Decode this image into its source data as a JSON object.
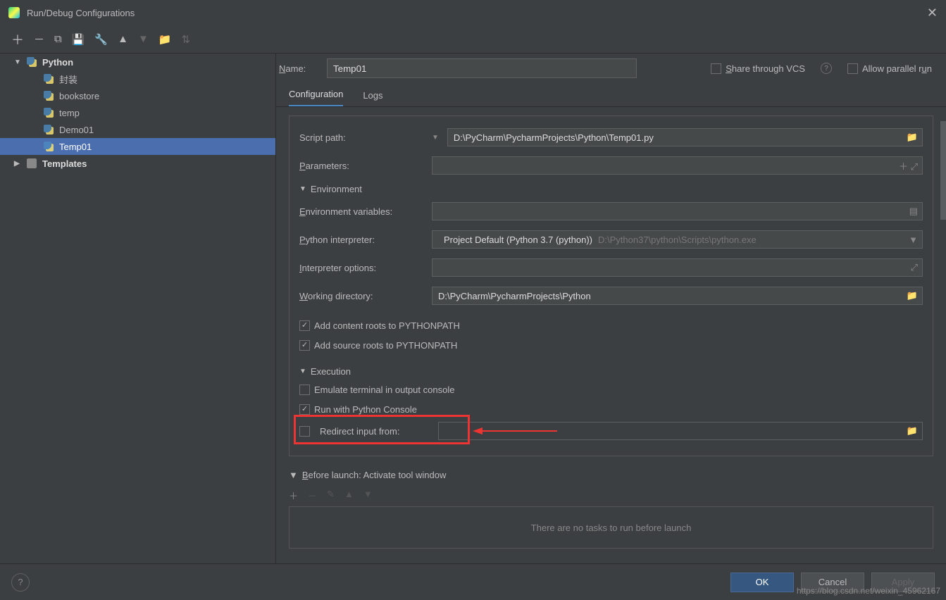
{
  "window": {
    "title": "Run/Debug Configurations"
  },
  "sidebar": {
    "group": "Python",
    "items": [
      "封装",
      "bookstore",
      "temp",
      "Demo01",
      "Temp01"
    ],
    "selected_index": 4,
    "templates": "Templates"
  },
  "header": {
    "name_label": "Name:",
    "name_value": "Temp01",
    "share_label": "Share through VCS",
    "share_checked": false,
    "parallel_label": "Allow parallel run",
    "parallel_checked": false
  },
  "tabs": {
    "items": [
      "Configuration",
      "Logs"
    ],
    "active": 0
  },
  "config": {
    "script_path_label": "Script path:",
    "script_path_value": "D:\\PyCharm\\PycharmProjects\\Python\\Temp01.py",
    "parameters_label": "Parameters:",
    "parameters_value": "",
    "env_header": "Environment",
    "env_vars_label": "Environment variables:",
    "env_vars_value": "",
    "interpreter_label": "Python interpreter:",
    "interpreter_value": "Project Default (Python 3.7 (python))",
    "interpreter_path": "D:\\Python37\\python\\Scripts\\python.exe",
    "interpreter_opts_label": "Interpreter options:",
    "interpreter_opts_value": "",
    "working_dir_label": "Working directory:",
    "working_dir_value": "D:\\PyCharm\\PycharmProjects\\Python",
    "add_content_roots": "Add content roots to PYTHONPATH",
    "add_content_roots_checked": true,
    "add_source_roots": "Add source roots to PYTHONPATH",
    "add_source_roots_checked": true,
    "exec_header": "Execution",
    "emulate_terminal": "Emulate terminal in output console",
    "emulate_terminal_checked": false,
    "run_python_console": "Run with Python Console",
    "run_python_console_checked": true,
    "redirect_input_label": "Redirect input from:",
    "redirect_input_checked": false,
    "redirect_input_value": ""
  },
  "before_launch": {
    "header": "Before launch: Activate tool window",
    "empty_text": "There are no tasks to run before launch"
  },
  "footer": {
    "ok": "OK",
    "cancel": "Cancel",
    "apply": "Apply"
  },
  "watermark": "https://blog.csdn.net/weixin_45962167"
}
